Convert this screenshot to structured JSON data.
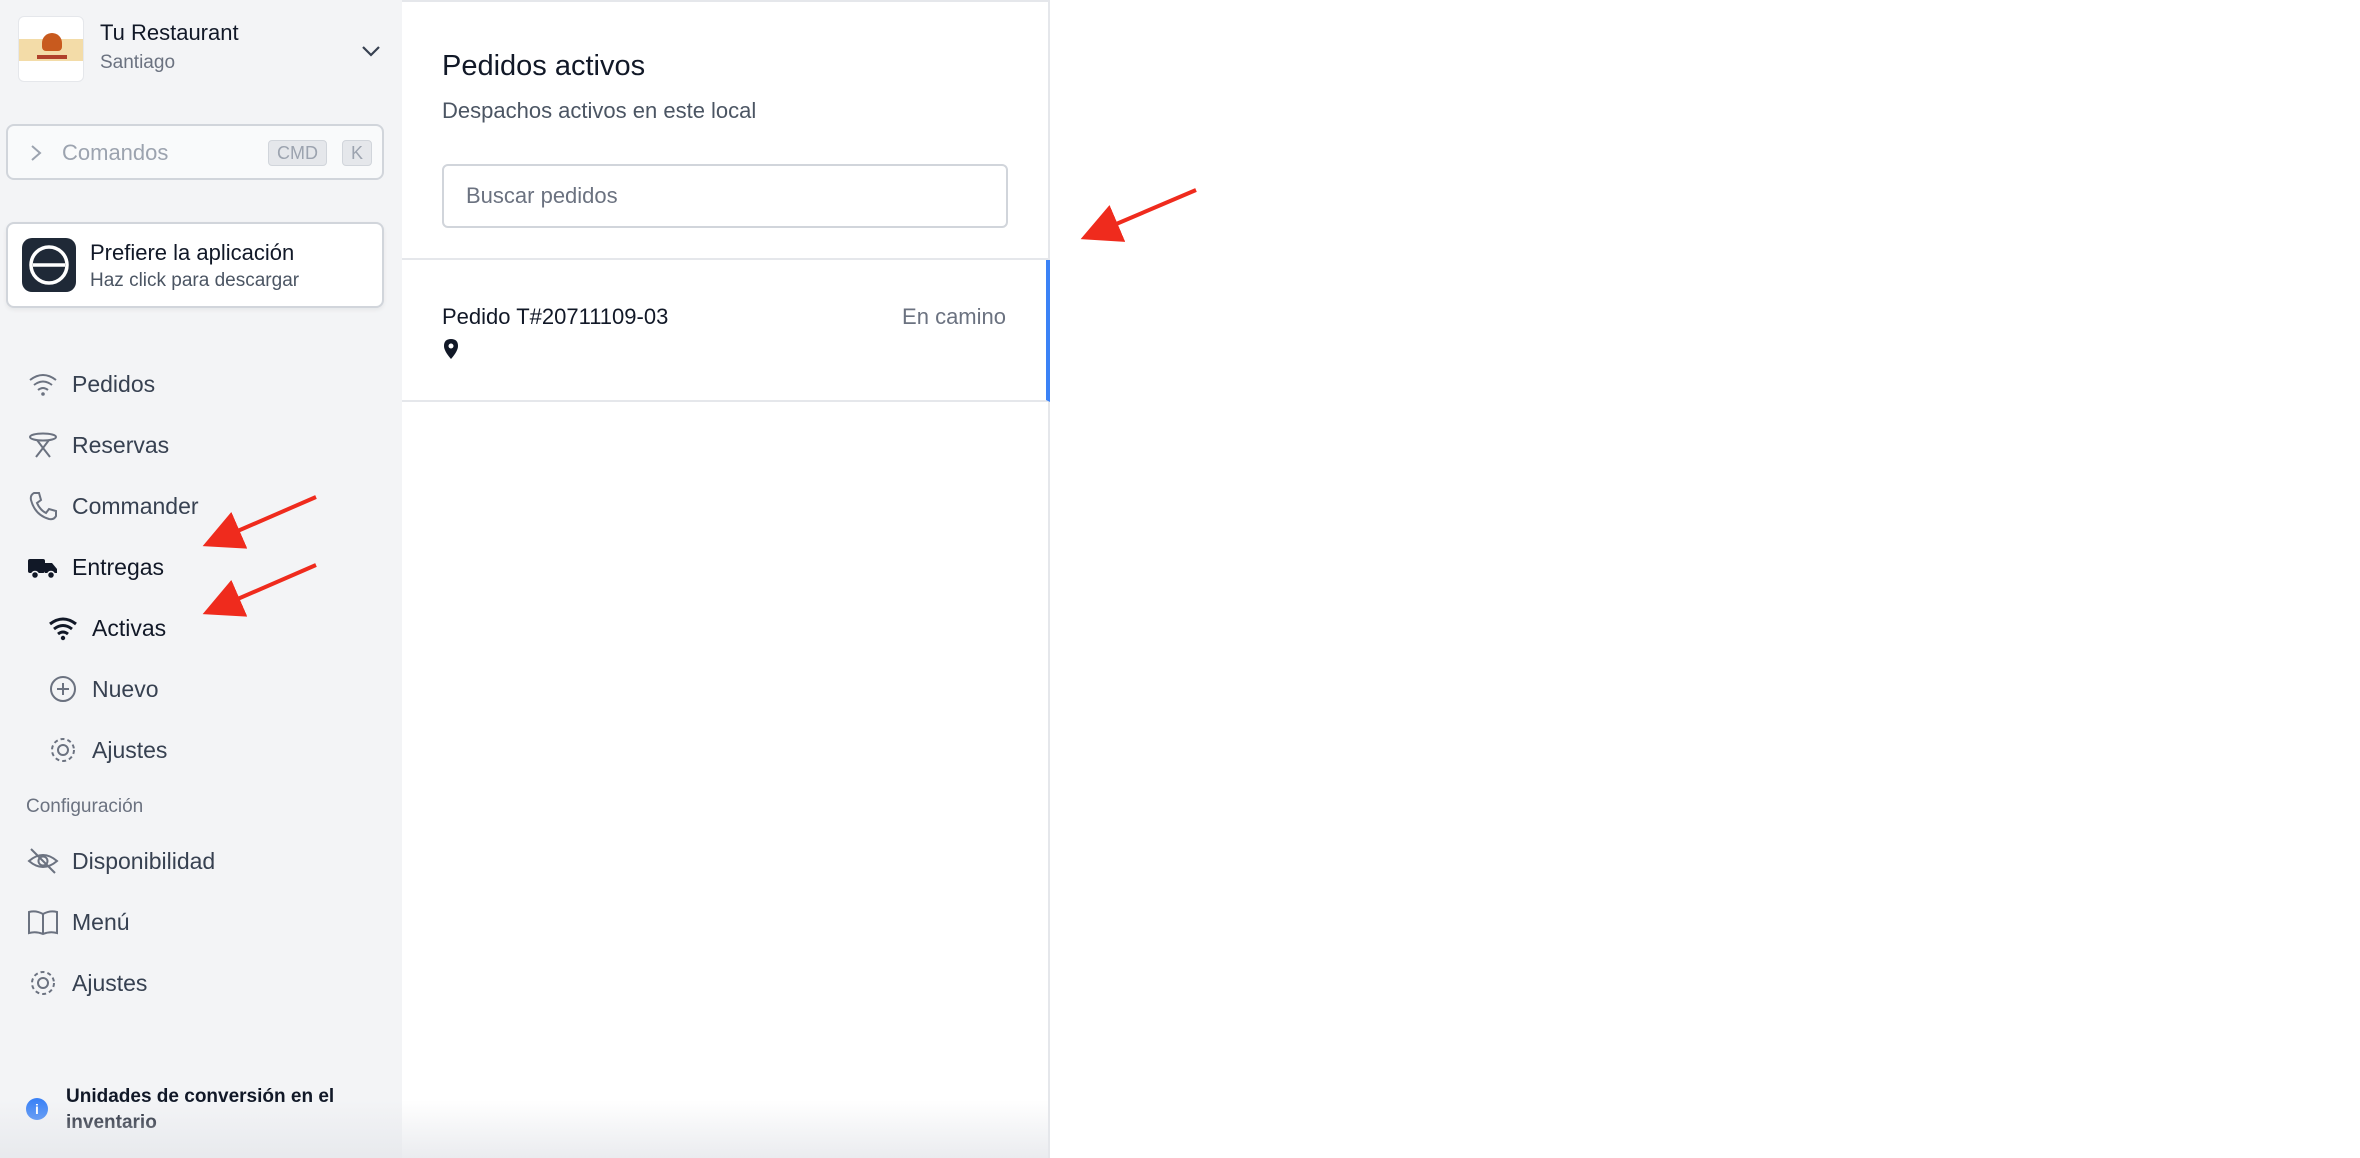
{
  "restaurant": {
    "name": "Tu Restaurant",
    "city": "Santiago"
  },
  "command_bar": {
    "placeholder": "Comandos",
    "key1": "CMD",
    "key2": "K"
  },
  "app_promo": {
    "title": "Prefiere la aplicación",
    "subtitle": "Haz click para descargar"
  },
  "nav": {
    "pedidos": "Pedidos",
    "reservas": "Reservas",
    "commander": "Commander",
    "entregas": "Entregas",
    "activas": "Activas",
    "nuevo": "Nuevo",
    "ajustes_entregas": "Ajustes"
  },
  "config": {
    "section": "Configuración",
    "disponibilidad": "Disponibilidad",
    "menu": "Menú",
    "ajustes": "Ajustes"
  },
  "notice": {
    "text": "Unidades de conversión en el inventario"
  },
  "panel": {
    "title": "Pedidos activos",
    "subtitle": "Despachos activos en este local",
    "search_placeholder": "Buscar pedidos"
  },
  "orders": [
    {
      "id": "Pedido T#20711109-03",
      "status": "En camino"
    }
  ],
  "colors": {
    "accent": "#3b82f6",
    "annotation": "#ef2b1d",
    "sidebar_bg": "#f3f4f6"
  }
}
